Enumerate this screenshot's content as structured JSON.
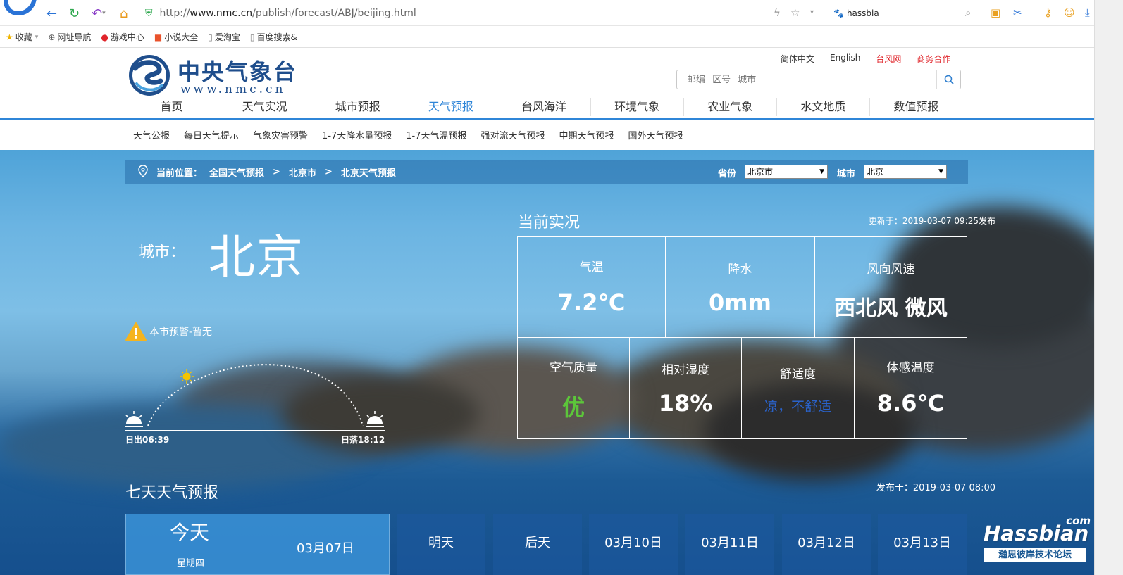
{
  "browser": {
    "url_prefix": "http://",
    "url_host": "www.nmc.cn",
    "url_path": "/publish/forecast/ABJ/beijing.html",
    "search_value": "hassbia"
  },
  "bookmarks": [
    {
      "label": "收藏",
      "icon": "star-icon"
    },
    {
      "label": "网址导航",
      "icon": "globe-icon"
    },
    {
      "label": "游戏中心",
      "icon": "game-icon"
    },
    {
      "label": "小说大全",
      "icon": "book-icon"
    },
    {
      "label": "爱淘宝",
      "icon": "page-icon"
    },
    {
      "label": "百度搜索&",
      "icon": "page-icon"
    }
  ],
  "header": {
    "logo_cn": "中央气象台",
    "logo_en": "www.nmc.cn",
    "top_links": [
      "简体中文",
      "English",
      "台风网",
      "商务合作"
    ],
    "search_placeholder": "邮编 区号 城市"
  },
  "main_nav": [
    "首页",
    "天气实况",
    "城市预报",
    "天气预报",
    "台风海洋",
    "环境气象",
    "农业气象",
    "水文地质",
    "数值预报"
  ],
  "main_nav_active": "天气预报",
  "sub_nav": [
    "天气公报",
    "每日天气提示",
    "气象灾害预警",
    "1-7天降水量预报",
    "1-7天气温预报",
    "强对流天气预报",
    "中期天气预报",
    "国外天气预报"
  ],
  "breadcrumb": {
    "label": "当前位置：",
    "items": [
      "全国天气预报",
      "北京市",
      "北京天气预报"
    ],
    "province_label": "省份",
    "province_value": "北京市",
    "city_label": "城市",
    "city_value": "北京"
  },
  "city": {
    "label": "城市：",
    "name": "北京",
    "warning": "本市预警-暂无",
    "sunrise": "日出06:39",
    "sunset": "日落18:12"
  },
  "current": {
    "title": "当前实况",
    "updated": "更新于：2019-03-07 09:25发布",
    "temperature": {
      "label": "气温",
      "value": "7.2℃"
    },
    "precipitation": {
      "label": "降水",
      "value": "0mm"
    },
    "wind": {
      "label": "风向风速",
      "value": "西北风 微风"
    },
    "air_quality": {
      "label": "空气质量",
      "value": "优",
      "color": "#5cc63a"
    },
    "humidity": {
      "label": "相对湿度",
      "value": "18%"
    },
    "comfort": {
      "label": "舒适度",
      "value": "凉，不舒适",
      "color": "#2a62c9"
    },
    "feels_like": {
      "label": "体感温度",
      "value": "8.6℃"
    }
  },
  "seven_day": {
    "title": "七天天气预报",
    "published": "发布于：2019-03-07 08:00",
    "today": {
      "label": "今天",
      "date": "03月07日",
      "weekday": "星期四"
    },
    "days": [
      "明天",
      "后天",
      "03月10日",
      "03月11日",
      "03月12日",
      "03月13日"
    ]
  },
  "watermark": {
    "brand": "Hassbian",
    "suffix": "com",
    "tagline": "瀚思彼岸技术论坛"
  }
}
